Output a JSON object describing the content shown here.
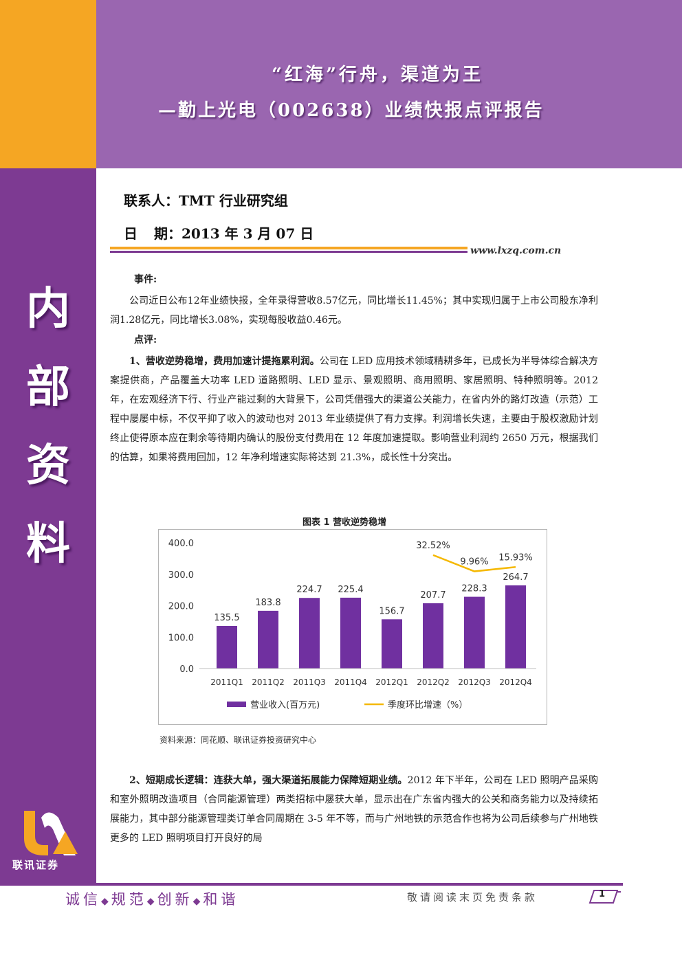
{
  "header": {
    "title_line1": "“红海”行舟，渠道为王",
    "title_line2": "—勤上光电（002638）业绩快报点评报告"
  },
  "meta": {
    "contact_label": "联系人：",
    "contact_value": "TMT 行业研究组",
    "date_label_a": "日",
    "date_label_b": "期：",
    "date_value": "2013 年 3 月 07 日",
    "website": "www.lxzq.com.cn"
  },
  "sidebar": {
    "chars": [
      "内",
      "部",
      "资",
      "料"
    ],
    "logo_text": "联讯证券"
  },
  "event": {
    "heading": "事件:",
    "text": "公司近日公布12年业绩快报，全年录得营收8.57亿元，同比增长11.45%；其中实现归属于上市公司股东净利润1.28亿元，同比增长3.08%，实现每股收益0.46元。"
  },
  "review": {
    "heading": "点评:",
    "para1_bold": "1、营收逆势稳增，费用加速计提拖累利润。",
    "para1_text": "公司在 LED 应用技术领域精耕多年，已成长为半导体综合解决方案提供商，产品覆盖大功率 LED 道路照明、LED 显示、景观照明、商用照明、家居照明、特种照明等。2012 年，在宏观经济下行、行业产能过剩的大背景下，公司凭借强大的渠道公关能力，在省内外的路灯改造（示范）工程中屡屡中标，不仅平抑了收入的波动也对 2013 年业绩提供了有力支撑。利润增长失速，主要由于股权激励计划终止使得原本应在剩余等待期内确认的股份支付费用在 12 年度加速提取。影响营业利润约 2650 万元，根据我们的估算，如果将费用回加，12 年净利增速实际将达到 21.3%，成长性十分突出。",
    "para2_bold": "2、短期成长逻辑：连获大单，强大渠道拓展能力保障短期业绩。",
    "para2_text": "2012 年下半年，公司在 LED 照明产品采购和室外照明改造项目（合同能源管理）两类招标中屡获大单，显示出在广东省内强大的公关和商务能力以及持续拓展能力，其中部分能源管理类订单合同周期在 3-5 年不等，而与广州地铁的示范合作也将为公司后续参与广州地铁更多的 LED 照明项目打开良好的局"
  },
  "figure": {
    "caption": "图表 1 营收逆势稳增",
    "source": "资料来源：同花顺、联讯证券投资研究中心"
  },
  "chart_data": {
    "type": "bar",
    "categories": [
      "2011Q1",
      "2011Q2",
      "2011Q3",
      "2011Q4",
      "2012Q1",
      "2012Q2",
      "2012Q3",
      "2012Q4"
    ],
    "series": [
      {
        "name": "营业收入(百万元)",
        "kind": "bar",
        "color": "#7030a0",
        "values": [
          135.5,
          183.8,
          224.7,
          225.4,
          156.7,
          207.7,
          228.3,
          264.7
        ],
        "labels": [
          "135.5",
          "183.8",
          "224.7",
          "225.4",
          "156.7",
          "207.7",
          "228.3",
          "264.7"
        ]
      },
      {
        "name": "季度环比增速（%）",
        "kind": "line",
        "color": "#f5b800",
        "points": [
          {
            "category": "2012Q2",
            "value": 32.52,
            "label": "32.52%"
          },
          {
            "category": "2012Q3",
            "value": 9.96,
            "label": "9.96%"
          },
          {
            "category": "2012Q4",
            "value": 15.93,
            "label": "15.93%"
          }
        ]
      }
    ],
    "y_ticks": [
      "400.0",
      "300.0",
      "200.0",
      "100.0",
      "0.0"
    ],
    "ylim": [
      0,
      400
    ],
    "grid": false,
    "legend_position": "bottom"
  },
  "footer": {
    "motto": [
      "诚信",
      "规范",
      "创新",
      "和谐"
    ],
    "motto_sep": "◆",
    "disclaimer": "敬请阅读末页免责条款",
    "page_number": "1"
  },
  "colors": {
    "brand_purple": "#7d3a92",
    "header_purple": "#9a66b0",
    "accent_orange": "#f5a623"
  }
}
